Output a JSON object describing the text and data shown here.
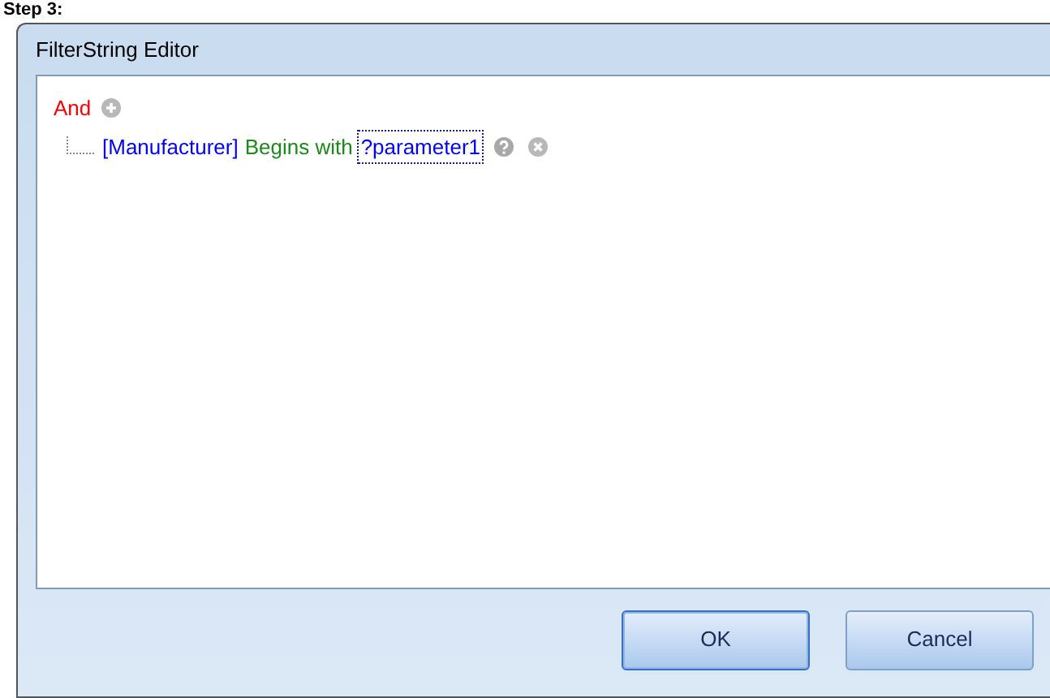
{
  "heading": "Step 3:",
  "window": {
    "title": "FilterString Editor"
  },
  "filter": {
    "group": {
      "operator": "And",
      "conditions": [
        {
          "field": "[Manufacturer]",
          "operation": "Begins with",
          "value": "?parameter1",
          "focused": true
        }
      ]
    }
  },
  "buttons": [
    {
      "label": "OK",
      "default": true
    },
    {
      "label": "Cancel",
      "default": false
    }
  ]
}
